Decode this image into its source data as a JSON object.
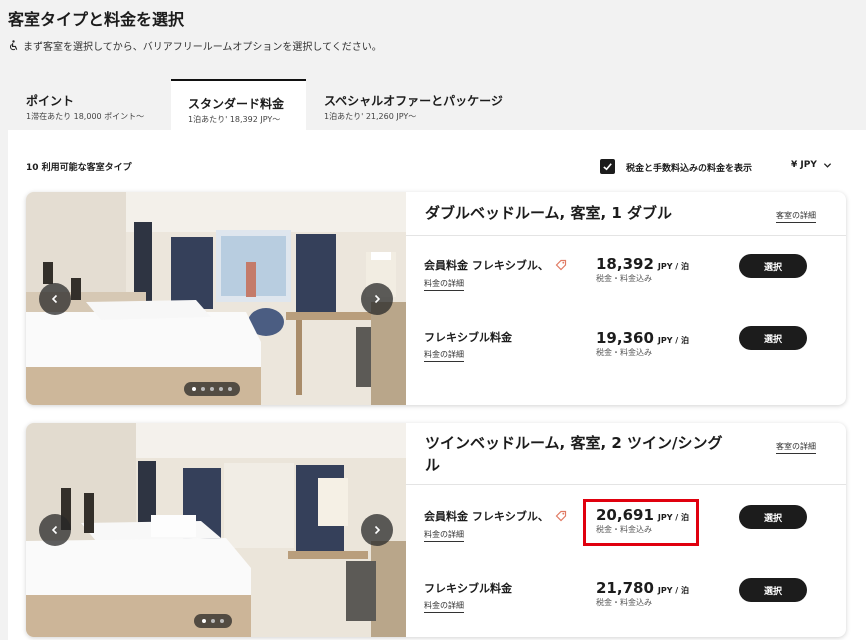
{
  "page": {
    "title": "客室タイプと料金を選択",
    "notice": "まず客室を選択してから、バリアフリールームオプションを選択してください。"
  },
  "tabs": [
    {
      "title": "ポイント",
      "sub": "1滞在あたり 18,000 ポイント〜"
    },
    {
      "title": "スタンダード料金",
      "sub": "1泊あたり' 18,392 JPY〜"
    },
    {
      "title": "スペシャルオファーとパッケージ",
      "sub": "1泊あたり' 21,260 JPY〜"
    }
  ],
  "filters": {
    "rooms_count": "10 利用可能な客室タイプ",
    "tax_label": "税金と手数料込みの料金を表示",
    "tax_checked": true,
    "currency": "¥ JPY"
  },
  "rooms": [
    {
      "title": "ダブルベッドルーム, 客室, 1 ダブル",
      "details_label": "客室の詳細",
      "image_dots": 5,
      "rates": [
        {
          "name": "会員料金 フレキシブル、",
          "link": "料金の詳細",
          "price": "18,392",
          "unit": "JPY / 泊",
          "note": "税金・料金込み",
          "button": "選択",
          "tag_icon": true
        },
        {
          "name": "フレキシブル料金",
          "link": "料金の詳細",
          "price": "19,360",
          "unit": "JPY / 泊",
          "note": "税金・料金込み",
          "button": "選択",
          "tag_icon": false
        }
      ]
    },
    {
      "title": "ツインベッドルーム, 客室, 2 ツイン/シングル",
      "details_label": "客室の詳細",
      "image_dots": 3,
      "rates": [
        {
          "name": "会員料金 フレキシブル、",
          "link": "料金の詳細",
          "price": "20,691",
          "unit": "JPY / 泊",
          "note": "税金・料金込み",
          "button": "選択",
          "tag_icon": true,
          "highlighted": true
        },
        {
          "name": "フレキシブル料金",
          "link": "料金の詳細",
          "price": "21,780",
          "unit": "JPY / 泊",
          "note": "税金・料金込み",
          "button": "選択",
          "tag_icon": false
        }
      ]
    }
  ],
  "colors": {
    "accent": "#1c1c1c",
    "highlight": "#e0000e",
    "background": "#f2f2f2",
    "tag_icon": "#e07a63"
  },
  "icons": [
    "accessibility-icon",
    "checkbox-check-icon",
    "chevron-down-icon",
    "chevron-left-icon",
    "chevron-right-icon",
    "price-tag-icon"
  ]
}
